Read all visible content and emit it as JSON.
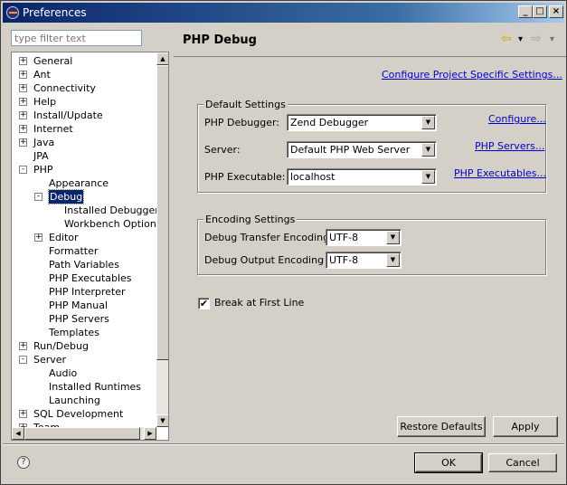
{
  "window": {
    "title": "Preferences"
  },
  "filter": {
    "placeholder": "type filter text"
  },
  "tree": [
    {
      "label": "General",
      "level": 0,
      "expander": "+"
    },
    {
      "label": "Ant",
      "level": 0,
      "expander": "+"
    },
    {
      "label": "Connectivity",
      "level": 0,
      "expander": "+"
    },
    {
      "label": "Help",
      "level": 0,
      "expander": "+"
    },
    {
      "label": "Install/Update",
      "level": 0,
      "expander": "+"
    },
    {
      "label": "Internet",
      "level": 0,
      "expander": "+"
    },
    {
      "label": "Java",
      "level": 0,
      "expander": "+"
    },
    {
      "label": "JPA",
      "level": 0,
      "expander": ""
    },
    {
      "label": "PHP",
      "level": 0,
      "expander": "-"
    },
    {
      "label": "Appearance",
      "level": 1,
      "expander": ""
    },
    {
      "label": "Debug",
      "level": 1,
      "expander": "-",
      "selected": true
    },
    {
      "label": "Installed Debuggers",
      "level": 2,
      "expander": ""
    },
    {
      "label": "Workbench Options",
      "level": 2,
      "expander": ""
    },
    {
      "label": "Editor",
      "level": 1,
      "expander": "+"
    },
    {
      "label": "Formatter",
      "level": 1,
      "expander": ""
    },
    {
      "label": "Path Variables",
      "level": 1,
      "expander": ""
    },
    {
      "label": "PHP Executables",
      "level": 1,
      "expander": ""
    },
    {
      "label": "PHP Interpreter",
      "level": 1,
      "expander": ""
    },
    {
      "label": "PHP Manual",
      "level": 1,
      "expander": ""
    },
    {
      "label": "PHP Servers",
      "level": 1,
      "expander": ""
    },
    {
      "label": "Templates",
      "level": 1,
      "expander": ""
    },
    {
      "label": "Run/Debug",
      "level": 0,
      "expander": "+"
    },
    {
      "label": "Server",
      "level": 0,
      "expander": "-"
    },
    {
      "label": "Audio",
      "level": 1,
      "expander": ""
    },
    {
      "label": "Installed Runtimes",
      "level": 1,
      "expander": ""
    },
    {
      "label": "Launching",
      "level": 1,
      "expander": ""
    },
    {
      "label": "SQL Development",
      "level": 0,
      "expander": "+"
    },
    {
      "label": "Team",
      "level": 0,
      "expander": "+"
    }
  ],
  "page": {
    "title": "PHP Debug",
    "project_link": "Configure Project Specific Settings...",
    "default_settings": {
      "legend": "Default Settings",
      "debugger_label": "PHP Debugger:",
      "debugger_value": "Zend Debugger",
      "configure_link": "Configure...",
      "server_label": "Server:",
      "server_value": "Default PHP Web Server",
      "servers_link": "PHP Servers...",
      "exec_label": "PHP Executable:",
      "exec_value": "localhost",
      "execs_link": "PHP Executables..."
    },
    "encoding_settings": {
      "legend": "Encoding Settings",
      "transfer_label": "Debug Transfer Encoding",
      "transfer_value": "UTF-8",
      "output_label": "Debug Output Encoding",
      "output_value": "UTF-8"
    },
    "break_first_line": {
      "label": "Break at First Line",
      "checked": true
    },
    "restore_defaults": "Restore Defaults",
    "apply": "Apply"
  },
  "footer": {
    "ok": "OK",
    "cancel": "Cancel"
  },
  "icons": {
    "help": "?",
    "back": "⇦",
    "forward": "⇨",
    "dropdown": "▾",
    "minimize": "_",
    "maximize": "□",
    "close": "×",
    "up": "▲",
    "down": "▼",
    "left": "◀",
    "right": "▶",
    "combo": "▼",
    "check": "✔"
  }
}
